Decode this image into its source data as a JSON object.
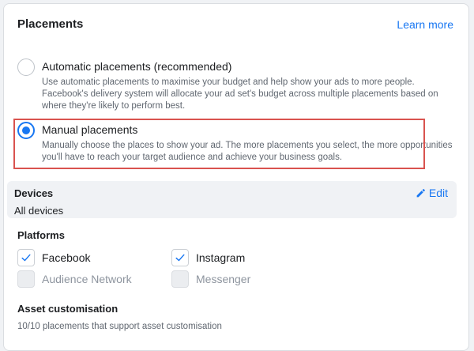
{
  "placements": {
    "title": "Placements",
    "learn_more": "Learn more"
  },
  "options": {
    "automatic": {
      "label": "Automatic placements (recommended)",
      "description": "Use automatic placements to maximise your budget and help show your ads to more people. Facebook's delivery system will allocate your ad set's budget across multiple placements based on where they're likely to perform best.",
      "selected": false
    },
    "manual": {
      "label": "Manual placements",
      "description": "Manually choose the places to show your ad. The more placements you select, the more opportunities you'll have to reach your target audience and achieve your business goals.",
      "selected": true
    }
  },
  "devices": {
    "title": "Devices",
    "value": "All devices",
    "edit_label": "Edit"
  },
  "platforms": {
    "title": "Platforms",
    "items": [
      {
        "label": "Facebook",
        "checked": true,
        "enabled": true
      },
      {
        "label": "Instagram",
        "checked": true,
        "enabled": true
      },
      {
        "label": "Audience Network",
        "checked": false,
        "enabled": false
      },
      {
        "label": "Messenger",
        "checked": false,
        "enabled": false
      }
    ]
  },
  "asset_customisation": {
    "title": "Asset customisation",
    "description": "10/10 placements that support asset customisation"
  },
  "colors": {
    "accent": "#1877f2",
    "highlight_border": "#d9534f",
    "muted_text": "#606770",
    "disabled_text": "#8d949e"
  },
  "icons": {
    "edit": "pencil-icon",
    "check": "checkmark-icon"
  }
}
